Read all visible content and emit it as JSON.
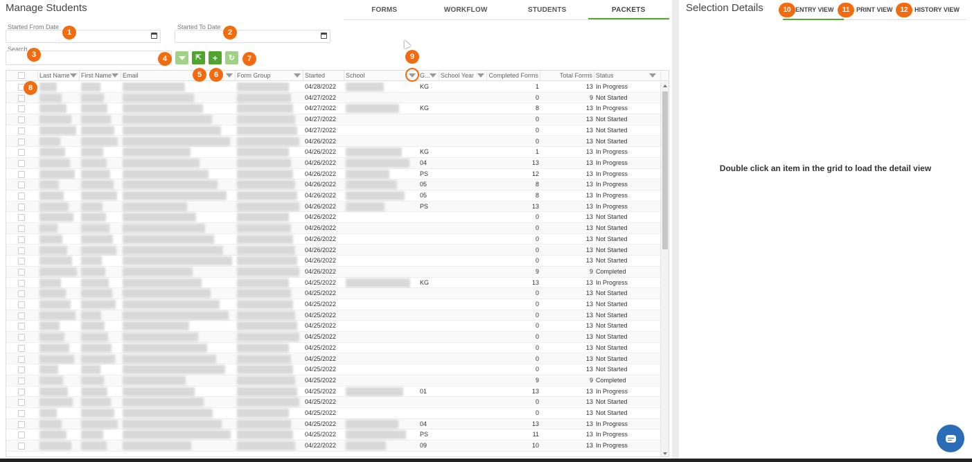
{
  "page": {
    "title": "Manage Students"
  },
  "nav": {
    "tabs": [
      {
        "label": "FORMS",
        "active": false
      },
      {
        "label": "WORKFLOW",
        "active": false
      },
      {
        "label": "STUDENTS",
        "active": false
      },
      {
        "label": "PACKETS",
        "active": true
      }
    ]
  },
  "filters": {
    "started_from_label": "Started From Date",
    "started_to_label": "Started To Date",
    "search_label": "Search"
  },
  "toolbar": {
    "clear_filter_icon": "funnel-icon",
    "export_icon": "export-icon",
    "add_label": "+",
    "refresh_icon": "refresh-icon"
  },
  "grid": {
    "columns": [
      "",
      "Last Name",
      "First Name",
      "Email",
      "Form Group",
      "Started",
      "School",
      "G...",
      "School Year",
      "Completed Forms",
      "Total Forms",
      "Status"
    ],
    "rows": [
      {
        "started": "04/28/2022",
        "grade": "KG",
        "completed": "1",
        "total": "13",
        "status": "In Progress"
      },
      {
        "started": "04/27/2022",
        "grade": "",
        "completed": "0",
        "total": "9",
        "status": "Not Started"
      },
      {
        "started": "04/27/2022",
        "grade": "KG",
        "completed": "8",
        "total": "13",
        "status": "In Progress"
      },
      {
        "started": "04/27/2022",
        "grade": "",
        "completed": "0",
        "total": "13",
        "status": "Not Started"
      },
      {
        "started": "04/27/2022",
        "grade": "",
        "completed": "0",
        "total": "13",
        "status": "Not Started"
      },
      {
        "started": "04/26/2022",
        "grade": "",
        "completed": "0",
        "total": "13",
        "status": "Not Started"
      },
      {
        "started": "04/26/2022",
        "grade": "KG",
        "completed": "1",
        "total": "13",
        "status": "In Progress"
      },
      {
        "started": "04/26/2022",
        "grade": "04",
        "completed": "13",
        "total": "13",
        "status": "In Progress"
      },
      {
        "started": "04/26/2022",
        "grade": "PS",
        "completed": "12",
        "total": "13",
        "status": "In Progress"
      },
      {
        "started": "04/26/2022",
        "grade": "05",
        "completed": "8",
        "total": "13",
        "status": "In Progress"
      },
      {
        "started": "04/26/2022",
        "grade": "05",
        "completed": "8",
        "total": "13",
        "status": "In Progress"
      },
      {
        "started": "04/26/2022",
        "grade": "PS",
        "completed": "13",
        "total": "13",
        "status": "In Progress"
      },
      {
        "started": "04/26/2022",
        "grade": "",
        "completed": "0",
        "total": "13",
        "status": "Not Started"
      },
      {
        "started": "04/26/2022",
        "grade": "",
        "completed": "0",
        "total": "13",
        "status": "Not Started"
      },
      {
        "started": "04/26/2022",
        "grade": "",
        "completed": "0",
        "total": "13",
        "status": "Not Started"
      },
      {
        "started": "04/26/2022",
        "grade": "",
        "completed": "0",
        "total": "13",
        "status": "Not Started"
      },
      {
        "started": "04/26/2022",
        "grade": "",
        "completed": "0",
        "total": "13",
        "status": "Not Started"
      },
      {
        "started": "04/26/2022",
        "grade": "",
        "completed": "9",
        "total": "9",
        "status": "Completed"
      },
      {
        "started": "04/25/2022",
        "grade": "KG",
        "completed": "13",
        "total": "13",
        "status": "In Progress"
      },
      {
        "started": "04/25/2022",
        "grade": "",
        "completed": "0",
        "total": "13",
        "status": "Not Started"
      },
      {
        "started": "04/25/2022",
        "grade": "",
        "completed": "0",
        "total": "13",
        "status": "Not Started"
      },
      {
        "started": "04/25/2022",
        "grade": "",
        "completed": "0",
        "total": "13",
        "status": "Not Started"
      },
      {
        "started": "04/25/2022",
        "grade": "",
        "completed": "0",
        "total": "13",
        "status": "Not Started"
      },
      {
        "started": "04/25/2022",
        "grade": "",
        "completed": "0",
        "total": "13",
        "status": "Not Started"
      },
      {
        "started": "04/25/2022",
        "grade": "",
        "completed": "0",
        "total": "13",
        "status": "Not Started"
      },
      {
        "started": "04/25/2022",
        "grade": "",
        "completed": "0",
        "total": "13",
        "status": "Not Started"
      },
      {
        "started": "04/25/2022",
        "grade": "",
        "completed": "0",
        "total": "13",
        "status": "Not Started"
      },
      {
        "started": "04/25/2022",
        "grade": "",
        "completed": "9",
        "total": "9",
        "status": "Completed"
      },
      {
        "started": "04/25/2022",
        "grade": "01",
        "completed": "13",
        "total": "13",
        "status": "In Progress"
      },
      {
        "started": "04/25/2022",
        "grade": "",
        "completed": "0",
        "total": "13",
        "status": "Not Started"
      },
      {
        "started": "04/25/2022",
        "grade": "",
        "completed": "0",
        "total": "13",
        "status": "Not Started"
      },
      {
        "started": "04/25/2022",
        "grade": "04",
        "completed": "13",
        "total": "13",
        "status": "In Progress"
      },
      {
        "started": "04/25/2022",
        "grade": "PS",
        "completed": "11",
        "total": "13",
        "status": "In Progress"
      },
      {
        "started": "04/22/2022",
        "grade": "09",
        "completed": "10",
        "total": "13",
        "status": "In Progress"
      }
    ]
  },
  "details": {
    "title": "Selection Details",
    "tabs": [
      "ENTRY VIEW",
      "PRINT VIEW",
      "HISTORY VIEW"
    ],
    "hint": "Double click an item in the grid to load the detail view"
  },
  "annotations": {
    "color": "#f26b0f",
    "labels": [
      "1",
      "2",
      "3",
      "4",
      "5",
      "6",
      "7",
      "8",
      "9",
      "10",
      "11",
      "12"
    ]
  },
  "colors": {
    "accent_green": "#4fa52e",
    "light_green": "#9fd187",
    "chat_blue": "#2b6cb7"
  }
}
